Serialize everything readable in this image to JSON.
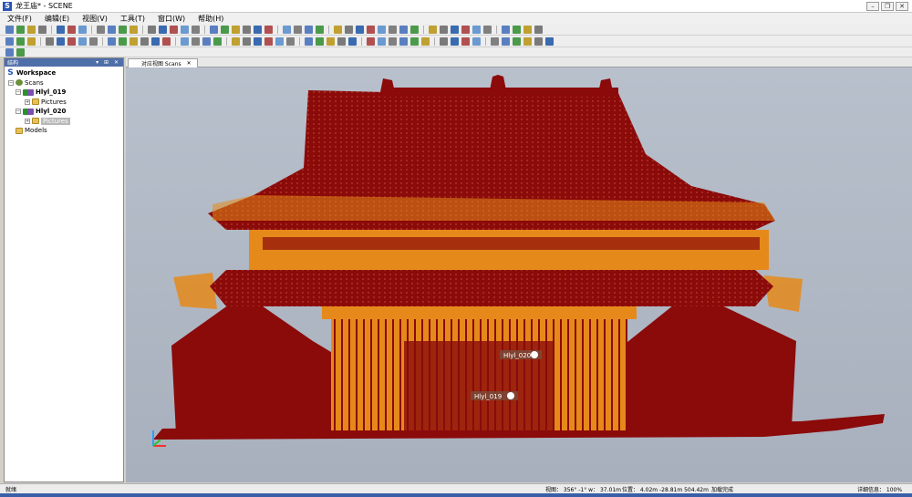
{
  "window": {
    "title": "龙王庙* - SCENE",
    "app_letter": "S"
  },
  "menu": [
    "文件(F)",
    "编辑(E)",
    "视图(V)",
    "工具(T)",
    "窗口(W)",
    "帮助(H)"
  ],
  "panel": {
    "title": "结构",
    "buttons": "▾ ⊞ ✕"
  },
  "tree": {
    "workspace": "Workspace",
    "scans": "Scans",
    "scan1": "Hlyl_019",
    "pictures1": "Pictures",
    "scan2": "Hlyl_020",
    "pictures2": "Pictures",
    "models": "Models"
  },
  "tab": {
    "label": "对应视图 Scans",
    "close": "✕"
  },
  "scan_labels": {
    "a": "Hlyl_020",
    "b": "Hlyl_019"
  },
  "status": {
    "ready": "就绪",
    "view": "视图： 356° -1° w： 37.01m",
    "position": "位置： 4.02m -28.81m 504.42m",
    "loaded": "加载完成",
    "detail": "详细信息： 100%"
  },
  "colors": {
    "roof": "#8b0a0a",
    "orange": "#e58a1a",
    "background": "#aab2bf",
    "panel_header": "#4f6fa8"
  }
}
